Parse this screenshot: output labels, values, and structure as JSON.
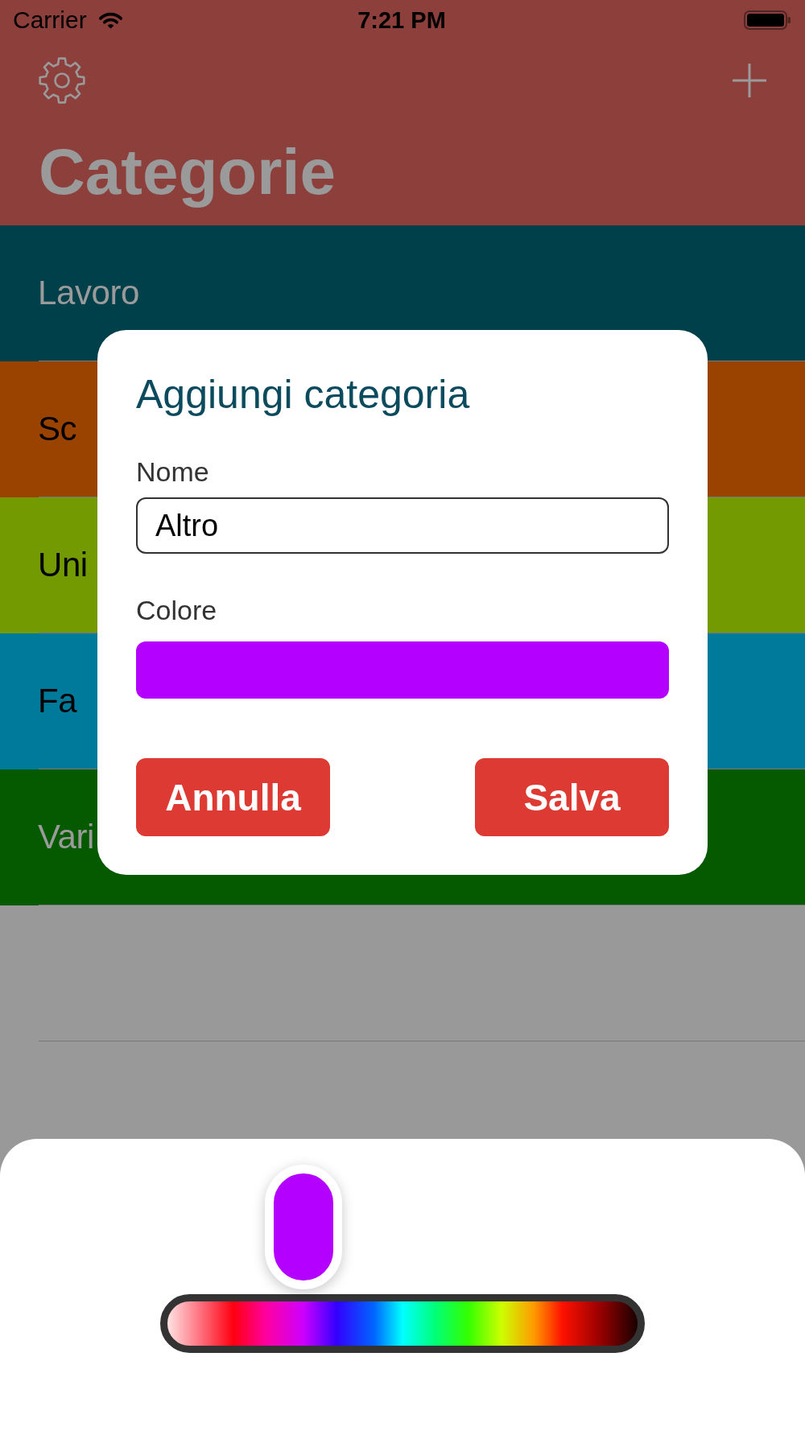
{
  "status_bar": {
    "carrier": "Carrier",
    "time": "7:21 PM"
  },
  "header": {
    "title": "Categorie"
  },
  "categories": [
    {
      "name": "Lavoro",
      "color": "#00404a"
    },
    {
      "name": "Sc",
      "color": "#9a4300"
    },
    {
      "name": "Uni",
      "color": "#739a00"
    },
    {
      "name": "Fa",
      "color": "#007a9a"
    },
    {
      "name": "Vari",
      "color": "#055a00"
    }
  ],
  "dialog": {
    "title": "Aggiungi categoria",
    "name_field": {
      "label": "Nome",
      "value": "Altro"
    },
    "color_field": {
      "label": "Colore",
      "color": "#b400ff"
    },
    "buttons": [
      "Annulla",
      "Salva"
    ]
  },
  "color_picker": {
    "level": 0.29,
    "color": "#b400ff"
  }
}
